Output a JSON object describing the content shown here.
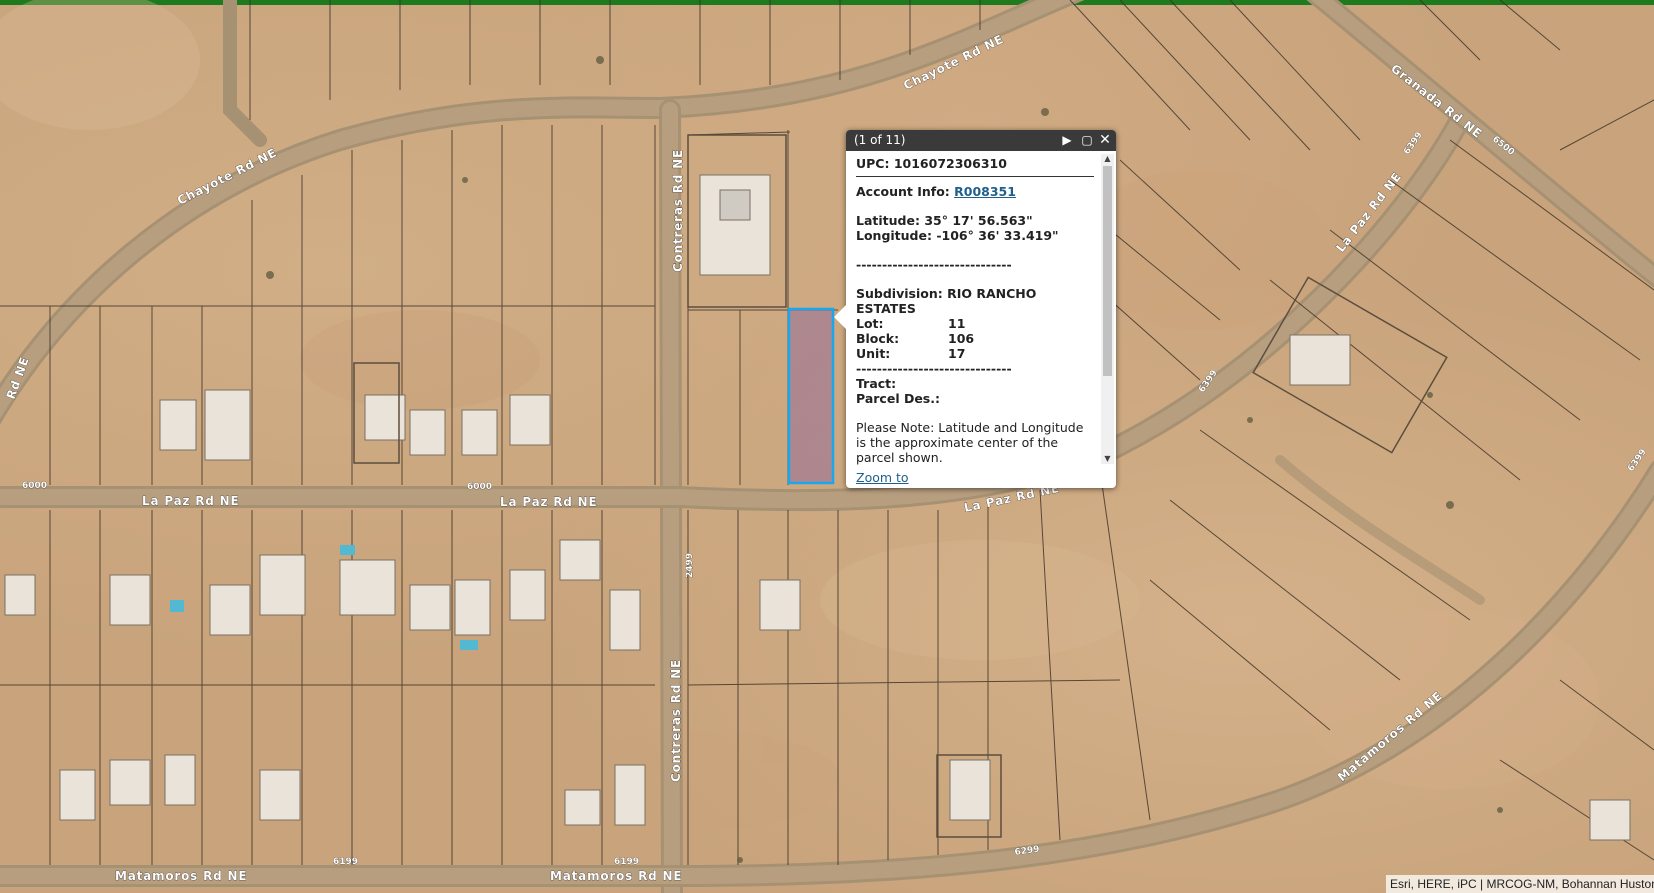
{
  "map": {
    "roads": {
      "chayote_upper": "Chayote Rd NE",
      "chayote_left": "Chayote Rd NE",
      "contreras_upper": "Contreras Rd NE",
      "contreras_lower": "Contreras Rd NE",
      "lapaz_left": "La Paz Rd NE",
      "lapaz_mid": "La Paz Rd NE",
      "lapaz_right": "La Paz Rd NE",
      "granada": "Granada Rd NE",
      "lapaz_upper_right": "La Paz Rd NE",
      "matamoros_left": "Matamoros Rd NE",
      "matamoros_mid": "Matamoros Rd NE",
      "matamoros_right": "Matamoros Rd NE",
      "partial_left": "Rd NE"
    },
    "addresses": {
      "a6000_left": "6000",
      "a6000_mid": "6000",
      "a2499": "2499",
      "a6399_a": "6399",
      "a6399_b": "6399",
      "a6399_c": "6399",
      "a6500": "6500",
      "a6199_a": "6199",
      "a6199_b": "6199",
      "a6299": "6299"
    },
    "attribution": "Esri, HERE, iPC | MRCOG-NM, Bohannan Huston"
  },
  "popup": {
    "counter": "(1 of 11)",
    "upc_label": "UPC:",
    "upc_value": "1016072306310",
    "account_label": "Account Info:",
    "account_value": "R008351",
    "latitude_label": "Latitude:",
    "latitude_value": "35° 17' 56.563\"",
    "longitude_label": "Longitude:",
    "longitude_value": "-106° 36' 33.419\"",
    "divider": "------------------------------",
    "subdivision_label": "Subdivision:",
    "subdivision_value": "RIO RANCHO ESTATES",
    "lot_label": "Lot:",
    "lot_value": "11",
    "block_label": "Block:",
    "block_value": "106",
    "unit_label": "Unit:",
    "unit_value": "17",
    "tract_label": "Tract:",
    "parcel_label": "Parcel Des.:",
    "note": "Please Note: Latitude and Longitude is the approximate center of the parcel shown.",
    "zoom_to": "Zoom to",
    "icons": {
      "next": "next-arrow-icon",
      "maximize": "maximize-icon",
      "close": "close-icon"
    }
  },
  "colors": {
    "header_bar": "#1d7a1d",
    "popup_header": "#3a3a3a",
    "selected_parcel_outline": "#19a8f0",
    "selected_parcel_fill": "#8a5fa0",
    "link": "#1f5f8b"
  }
}
